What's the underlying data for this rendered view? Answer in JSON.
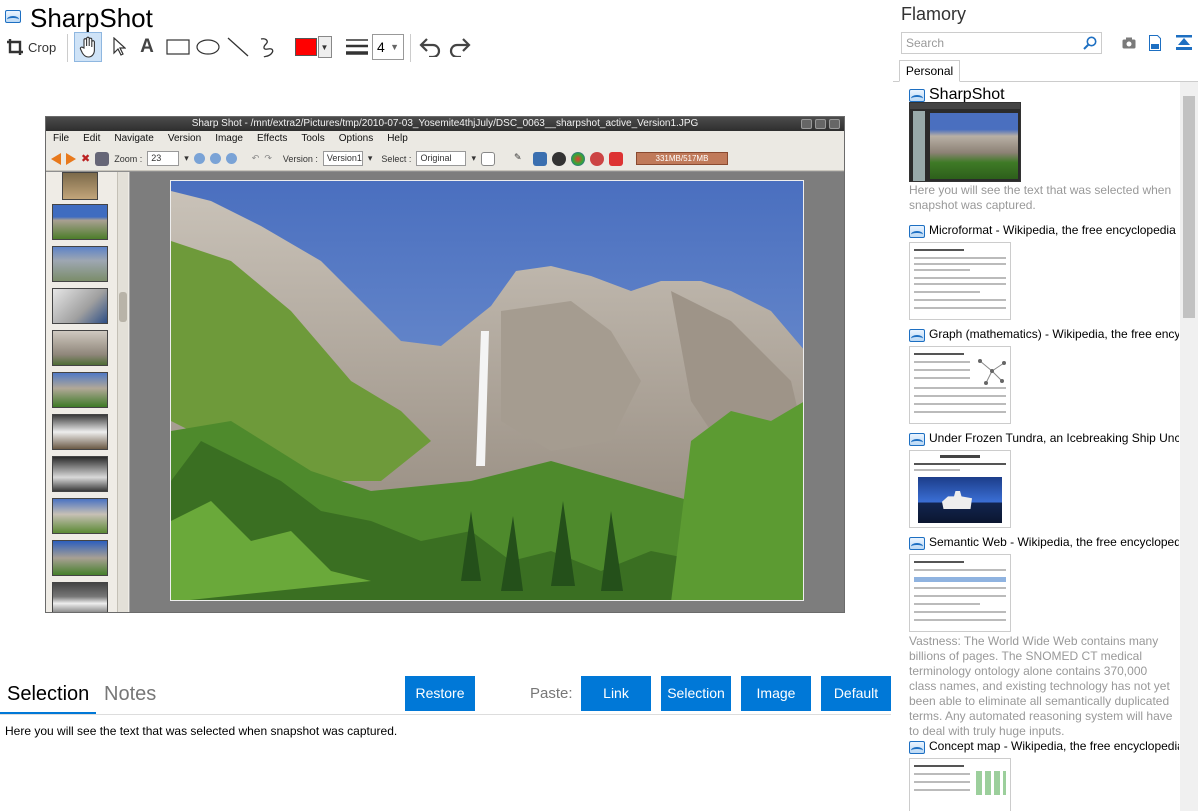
{
  "app": {
    "title": "SharpShot"
  },
  "toolbar": {
    "crop_label": "Crop",
    "line_width": "4",
    "colors": {
      "pen": "#ff0000",
      "accent": "#0078d7"
    },
    "icons": [
      "crop-icon",
      "hand-icon",
      "pointer-icon",
      "text-icon",
      "rectangle-icon",
      "ellipse-icon",
      "line-icon",
      "freehand-icon",
      "line-width-icon",
      "undo-icon",
      "redo-icon"
    ]
  },
  "screenshot": {
    "title": "Sharp Shot - /mnt/extra2/Pictures/tmp/2010-07-03_Yosemite4thjJuly/DSC_0063__sharpshot_active_Version1.JPG",
    "menu": [
      "File",
      "Edit",
      "Navigate",
      "Version",
      "Image",
      "Effects",
      "Tools",
      "Options",
      "Help"
    ],
    "zoom_label": "Zoom :",
    "zoom_value": "23",
    "version_label": "Version :",
    "version_value": "Version1",
    "select_label": "Select :",
    "select_value": "Original",
    "memory": "331MB/517MB"
  },
  "tabs": {
    "selection": "Selection",
    "notes": "Notes"
  },
  "buttons": {
    "restore": "Restore",
    "paste_label": "Paste:",
    "link": "Link",
    "selection": "Selection",
    "image": "Image",
    "default": "Default"
  },
  "selection_text": "Here you will see the text that was selected when snapshot was captured.",
  "sidebar": {
    "title": "Flamory",
    "search_placeholder": "Search",
    "tab": "Personal",
    "items": [
      {
        "title": "SharpShot",
        "desc": "Here you will see the text that was selected when snapshot was captured."
      },
      {
        "title": "Microformat - Wikipedia, the free encyclopedia"
      },
      {
        "title": "Graph (mathematics) - Wikipedia, the free encyclopedia"
      },
      {
        "title": "Under Frozen Tundra, an Icebreaking Ship Uncovers"
      },
      {
        "title": "Semantic Web - Wikipedia, the free encyclopedia",
        "desc": "Vastness: The World Wide Web contains many billions of pages. The SNOMED CT medical terminology ontology alone contains 370,000 class names, and existing technology has not yet been able to eliminate all semantically duplicated terms. Any automated reasoning system will have to deal with truly huge inputs."
      },
      {
        "title": "Concept map - Wikipedia, the free encyclopedia"
      }
    ]
  }
}
